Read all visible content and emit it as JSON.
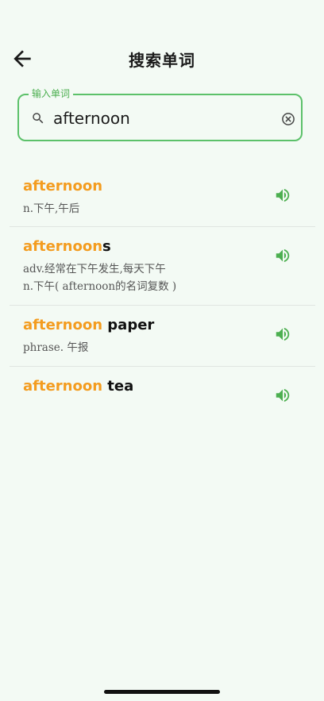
{
  "appbar": {
    "title": "搜索单词",
    "back_icon": "arrow-left-icon"
  },
  "search": {
    "legend": "输入单词",
    "value": "afternoon",
    "search_icon": "search-icon",
    "clear_icon": "clear-circle-icon"
  },
  "accent": "#f39c1f",
  "green": "#4caf50",
  "results": [
    {
      "highlight": "afternoon",
      "rest": "",
      "defs": [
        "n.下午,午后"
      ]
    },
    {
      "highlight": "afternoon",
      "rest": "s",
      "defs": [
        "adv.经常在下午发生,每天下午",
        "n.下午( afternoon的名词复数 )"
      ]
    },
    {
      "highlight": "afternoon",
      "rest": " paper",
      "defs": [
        "phrase. 午报"
      ]
    },
    {
      "highlight": "afternoon",
      "rest": " tea",
      "defs": []
    }
  ]
}
